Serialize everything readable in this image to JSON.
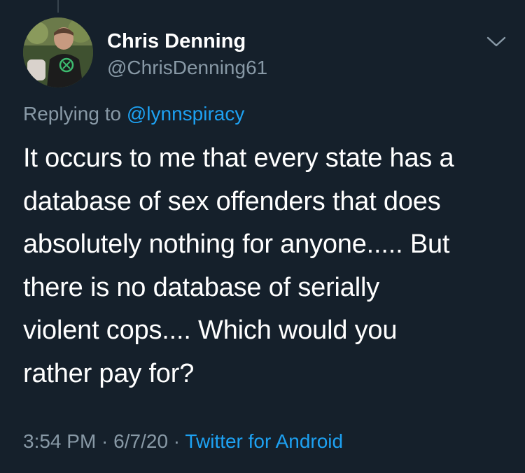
{
  "author": {
    "display_name": "Chris Denning",
    "handle": "@ChrisDenning61"
  },
  "reply": {
    "prefix": "Replying to ",
    "mention": "@lynnspiracy"
  },
  "tweet": {
    "lines": [
      "It occurs to me that every state has a",
      "database of sex offenders that does",
      "absolutely nothing for anyone..... But",
      "there is no database of serially",
      "violent cops.... Which would you",
      "rather pay for?"
    ]
  },
  "meta": {
    "time": "3:54 PM",
    "separator": " · ",
    "date": "6/7/20",
    "source": "Twitter for Android"
  },
  "icons": {
    "menu": "chevron-down-icon"
  },
  "colors": {
    "background": "#15202b",
    "text": "#ffffff",
    "secondary": "#8899a6",
    "accent": "#1da1f2"
  }
}
